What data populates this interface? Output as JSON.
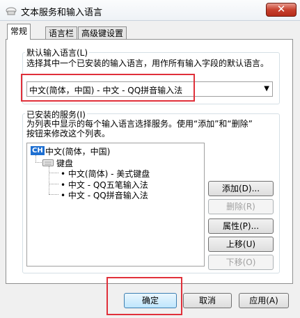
{
  "window": {
    "title": "文本服务和输入语言",
    "close_symbol": "✕"
  },
  "tabs": [
    {
      "label": "常规"
    },
    {
      "label": "语言栏"
    },
    {
      "label": "高级键设置"
    }
  ],
  "default_language": {
    "legend": "默认输入语言(L)",
    "description": "选择其中一个已安装的输入语言，用作所有输入字段的默认语言。",
    "selected": "中文(简体，中国) - 中文 - QQ拼音输入法"
  },
  "installed_services": {
    "legend": "已安装的服务(I)",
    "description_line1": "为列表中显示的每个输入语言选择服务。使用“添加”和“删除”",
    "description_line2": "按钮来修改这个列表。",
    "language_badge": "CH",
    "language": "中文(简体，中国)",
    "keyboard_label": "键盘",
    "services": [
      "中文(简体) - 美式键盘",
      "中文 - QQ五笔输入法",
      "中文 - QQ拼音输入法"
    ]
  },
  "side_buttons": {
    "add": "添加(D)...",
    "remove": "删除(R)",
    "properties": "属性(P)...",
    "move_up": "上移(U)",
    "move_down": "下移(O)"
  },
  "footer_buttons": {
    "ok": "确定",
    "cancel": "取消",
    "apply": "应用(A)"
  },
  "colors": {
    "highlight_box": "#e0303a",
    "language_badge": "#1e6fd1"
  }
}
